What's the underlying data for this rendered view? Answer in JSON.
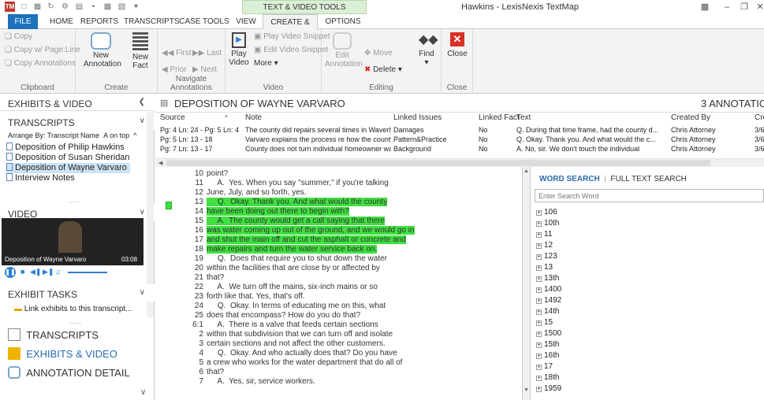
{
  "title_bar": {
    "context_tab": "TEXT & VIDEO TOOLS",
    "window_title": "Hawkins - LexisNexis TextMap"
  },
  "tabs": [
    "FILE",
    "HOME",
    "REPORTS",
    "TRANSCRIPTS",
    "CASE TOOLS",
    "VIEW",
    "CREATE & EDIT",
    "OPTIONS"
  ],
  "ribbon": {
    "clipboard": {
      "label": "Clipboard",
      "copy": "Copy",
      "copy_page_line": "Copy w/ Page:Line",
      "copy_annotations": "Copy Annotations"
    },
    "create": {
      "label": "Create",
      "new_annotation": "New Annotation",
      "new_fact": "New Fact"
    },
    "navigate": {
      "label": "Navigate Annotations",
      "first": "First",
      "last": "Last",
      "prior": "Prior",
      "next": "Next"
    },
    "video": {
      "label": "Video",
      "play_video": "Play Video",
      "play_snippet": "Play Video Snippet",
      "edit_snippet": "Edit Video Snippet",
      "more": "More"
    },
    "editing": {
      "label": "Editing",
      "edit_annotation": "Edit Annotation",
      "move": "Move",
      "delete": "Delete",
      "find": "Find"
    },
    "close": {
      "label": "Close",
      "close": "Close"
    }
  },
  "left": {
    "exhibits_video_header": "EXHIBITS & VIDEO",
    "transcripts_header": "TRANSCRIPTS",
    "arrange_by": "Arrange By: Transcript Name",
    "arrange_order": "A on top",
    "transcripts": [
      "Deposition of Philip Hawkins",
      "Deposition of Susan Sheridan",
      "Deposition of Wayne Varvaro",
      "Interview Notes"
    ],
    "video_header": "VIDEO",
    "video_caption": "Deposition of Wayne Varvaro",
    "video_time": "03:08",
    "exhibit_tasks_header": "EXHIBIT TASKS",
    "link_exhibits": "Link exhibits to this transcript...",
    "nav": [
      "TRANSCRIPTS",
      "EXHIBITS & VIDEO",
      "ANNOTATION DETAIL"
    ]
  },
  "deposition_title": "DEPOSITION OF WAYNE VARVARO",
  "annotation_count": "3 ANNOTATIO",
  "annotation_table": {
    "headers": [
      "Source",
      "Note",
      "Linked Issues",
      "Linked Fact",
      "Text",
      "Created By",
      "Cre"
    ],
    "rows": [
      [
        "Pg: 4 Ln: 24 - Pg: 5 Ln: 4",
        "The county did repairs several times in Waverly P...",
        "Damages",
        "No",
        "Q.  During that time frame, had the county d...",
        "Chris Attorney",
        "3/6"
      ],
      [
        "Pg: 5 Ln: 13 - 18",
        "Varvaro explains the process re how the county ...",
        "Pattern&Practice",
        "No",
        "Q.  Okay. Thank you. And what would the c...",
        "Chris Attorney",
        "3/6"
      ],
      [
        "Pg: 7 Ln: 13 - 17",
        "County does not turn individual homeowner wa...",
        "Background",
        "No",
        "A.  No, sir. We don't touch the individual",
        "Chris Attorney",
        "3/6"
      ]
    ]
  },
  "transcript_lines": [
    {
      "n": "10",
      "t": "point?",
      "hl": false
    },
    {
      "n": "11",
      "t": "     A.  Yes. When you say \"summer,\" if you're talking",
      "hl": false
    },
    {
      "n": "12",
      "t": "June, July, and so forth, yes.",
      "hl": false
    },
    {
      "n": "13",
      "t": "     Q.  Okay. Thank you. And what would the county",
      "hl": true
    },
    {
      "n": "14",
      "t": "have been doing out there to begin with?",
      "hl": true
    },
    {
      "n": "15",
      "t": "     A.  The county would get a call saying that there",
      "hl": true
    },
    {
      "n": "16",
      "t": "was water coming up out of the ground, and we would go in",
      "hl": true
    },
    {
      "n": "17",
      "t": "and shut the main off and cut the asphalt or concrete and",
      "hl": true
    },
    {
      "n": "18",
      "t": "make repairs and turn the water service back on.",
      "hl": true
    },
    {
      "n": "19",
      "t": "     Q.  Does that require you to shut down the water",
      "hl": false
    },
    {
      "n": "20",
      "t": "within the facilities that are close by or affected by",
      "hl": false
    },
    {
      "n": "21",
      "t": "that?",
      "hl": false
    },
    {
      "n": "22",
      "t": "     A.  We turn off the mains, six-inch mains or so",
      "hl": false
    },
    {
      "n": "23",
      "t": "forth like that. Yes, that's off.",
      "hl": false
    },
    {
      "n": "24",
      "t": "     Q.  Okay. In terms of educating me on this, what",
      "hl": false
    },
    {
      "n": "25",
      "t": "does that encompass? How do you do that?",
      "hl": false
    },
    {
      "n": "6:1",
      "t": "     A.  There is a valve that feeds certain sections",
      "hl": false
    },
    {
      "n": "2",
      "t": "within that subdivision that we can turn off and isolate",
      "hl": false
    },
    {
      "n": "3",
      "t": "certain sections and not affect the other customers.",
      "hl": false
    },
    {
      "n": "4",
      "t": "     Q.  Okay. And who actually does that? Do you have",
      "hl": false
    },
    {
      "n": "5",
      "t": "a crew who works for the water department that do all of",
      "hl": false
    },
    {
      "n": "6",
      "t": "that?",
      "hl": false
    },
    {
      "n": "7",
      "t": "     A.  Yes, sir, service workers.",
      "hl": false
    }
  ],
  "word_search": {
    "tab_word": "WORD SEARCH",
    "tab_full": "FULL TEXT SEARCH",
    "placeholder": "Enter Search Word",
    "words": [
      "106",
      "10th",
      "11",
      "12",
      "123",
      "13",
      "13th",
      "1400",
      "1492",
      "14th",
      "15",
      "1500",
      "15th",
      "16th",
      "17",
      "18th",
      "1959"
    ]
  }
}
